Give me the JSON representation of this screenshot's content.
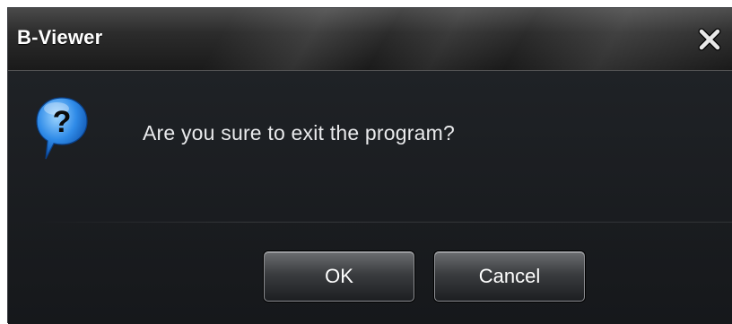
{
  "window": {
    "title": "B-Viewer",
    "close_icon": "close-icon"
  },
  "dialog": {
    "icon": "question-icon",
    "message": "Are you sure to exit the program?",
    "ok_label": "OK",
    "cancel_label": "Cancel"
  },
  "colors": {
    "background": "#1b1d21",
    "titlebar": "#2c2c2c",
    "text": "#e9eaec",
    "icon_blue": "#2f8be8"
  }
}
